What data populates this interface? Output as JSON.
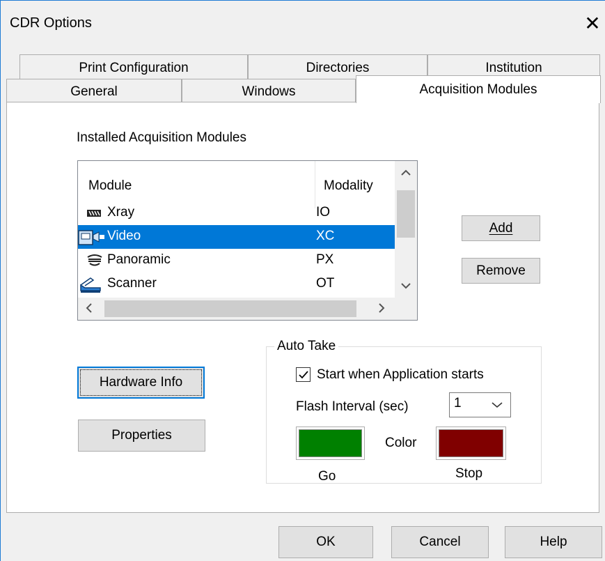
{
  "window": {
    "title": "CDR Options"
  },
  "tabs": {
    "row1": [
      "Print Configuration",
      "Directories",
      "Institution"
    ],
    "row2": [
      "General",
      "Windows",
      "Acquisition Modules"
    ],
    "active": "Acquisition Modules"
  },
  "installed_label": "Installed Acquisition Modules",
  "module_list": {
    "columns": [
      "Module",
      "Modality"
    ],
    "rows": [
      {
        "module": "Xray",
        "modality": "IO",
        "icon": "xray-icon"
      },
      {
        "module": "Video",
        "modality": "XC",
        "icon": "video-camera-icon",
        "selected": true
      },
      {
        "module": "Panoramic",
        "modality": "PX",
        "icon": "panoramic-icon"
      },
      {
        "module": "Scanner",
        "modality": "OT",
        "icon": "scanner-icon"
      }
    ]
  },
  "buttons": {
    "add": "Add",
    "remove": "Remove",
    "hardware_info": "Hardware Info",
    "properties": "Properties"
  },
  "auto_take": {
    "title": "Auto Take",
    "start_label": "Start when Application starts",
    "start_checked": true,
    "flash_label": "Flash Interval (sec)",
    "flash_value": "1",
    "color_label": "Color",
    "go_label": "Go",
    "stop_label": "Stop",
    "go_color": "#008000",
    "stop_color": "#800000"
  },
  "footer": {
    "ok": "OK",
    "cancel": "Cancel",
    "help": "Help"
  }
}
